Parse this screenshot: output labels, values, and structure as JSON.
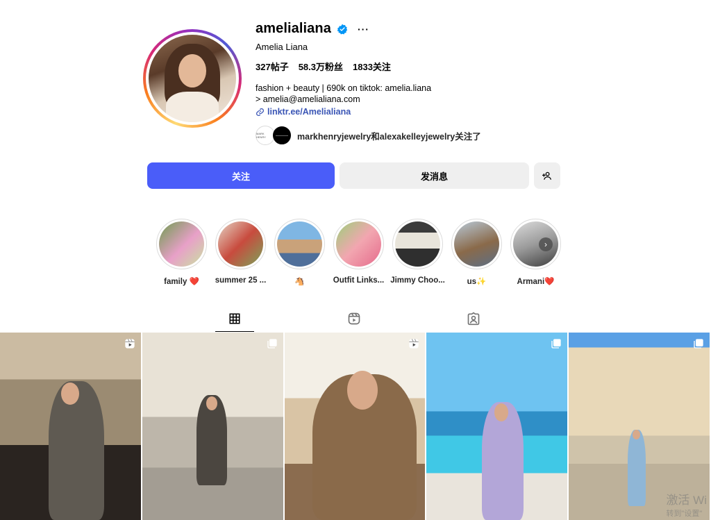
{
  "profile": {
    "username": "amelialiana",
    "more_label": "···",
    "full_name": "Amelia Liana",
    "stats": {
      "posts": "327帖子",
      "followers": "58.3万粉丝",
      "following": "1833关注"
    },
    "bio_line1": "fashion + beauty | 690k on tiktok: amelia.liana",
    "bio_line2": "> amelia@amelialiana.com",
    "link": "linktr.ee/Amelialiana",
    "followed_by_text": "markhenryjewelry和alexakelleyjewelry关注了",
    "followed_by_avatar1": "MARK HENRY"
  },
  "buttons": {
    "follow": "关注",
    "message": "发消息"
  },
  "highlights": [
    {
      "label": "family ❤️"
    },
    {
      "label": "summer 25 ..."
    },
    {
      "label": "🐴"
    },
    {
      "label": "Outfit Links..."
    },
    {
      "label": "Jimmy Choo..."
    },
    {
      "label": "us✨"
    },
    {
      "label": "Armani❤️"
    }
  ],
  "tabs": [
    "posts-grid-icon",
    "reels-icon",
    "tagged-icon"
  ],
  "posts": [
    {
      "type": "reel"
    },
    {
      "type": "carousel"
    },
    {
      "type": "reel"
    },
    {
      "type": "carousel"
    },
    {
      "type": "carousel"
    }
  ],
  "watermark": {
    "line1": "激活 Wi",
    "line2": "转到\"设置\""
  },
  "colors": {
    "follow_button": "#4a5df9",
    "link": "#3a55b5",
    "verified": "#0095f6"
  }
}
